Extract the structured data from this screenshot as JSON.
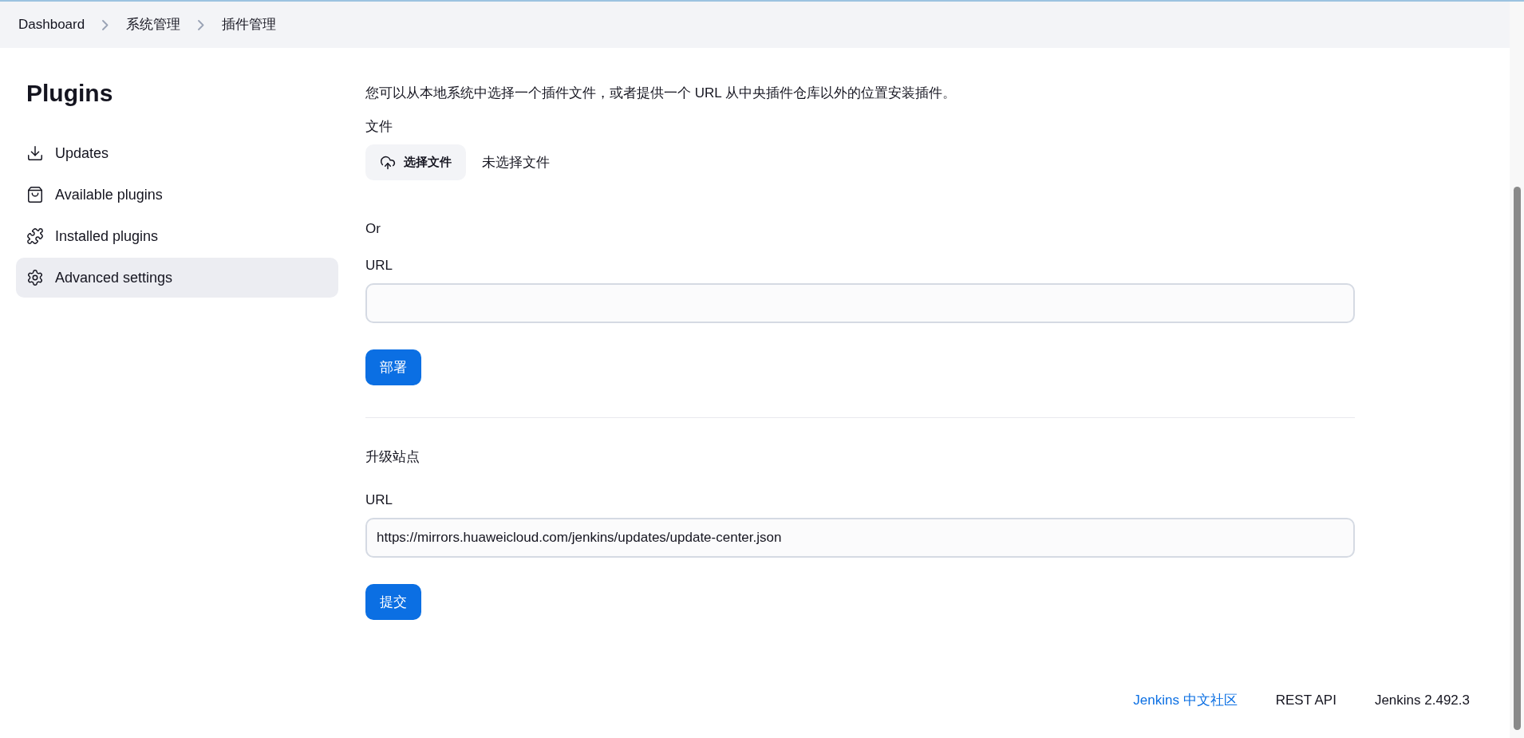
{
  "breadcrumb": [
    "Dashboard",
    "系统管理",
    "插件管理"
  ],
  "sidebar": {
    "title": "Plugins",
    "items": [
      {
        "label": "Updates",
        "kind": "download",
        "selected": false
      },
      {
        "label": "Available plugins",
        "kind": "bag",
        "selected": false
      },
      {
        "label": "Installed plugins",
        "kind": "puzzle",
        "selected": false
      },
      {
        "label": "Advanced settings",
        "kind": "gear",
        "selected": true
      }
    ]
  },
  "deploy": {
    "description": "您可以从本地系统中选择一个插件文件，或者提供一个 URL 从中央插件仓库以外的位置安装插件。",
    "file_label": "文件",
    "file_button": "选择文件",
    "file_status": "未选择文件",
    "or": "Or",
    "url_label": "URL",
    "button": "部署"
  },
  "update_site": {
    "title": "升级站点",
    "url_label": "URL",
    "url_value": "https://mirrors.huaweicloud.com/jenkins/updates/update-center.json",
    "button": "提交"
  },
  "footer": {
    "community_link": "Jenkins 中文社区",
    "rest_api": "REST API",
    "version": "Jenkins 2.492.3"
  }
}
